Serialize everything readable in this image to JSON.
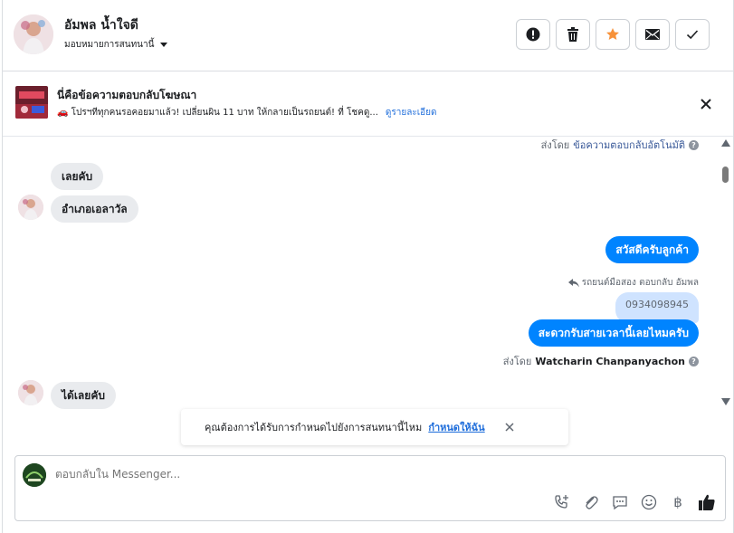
{
  "header": {
    "name": "อัมพล น้ำใจดี",
    "assign_label": "มอบหมายการสนทนานี้",
    "actions": [
      "mark-spam",
      "delete",
      "star",
      "mark-unread",
      "done"
    ]
  },
  "ad": {
    "title": "นี่คือข้อความตอบกลับโฆษณา",
    "snippet": "🚗 โปรฯทีทุกคนรอคอยมาแล้ว! เปลี่ยนผิน 11 บาท ให้กลายเป็นรถยนต์! ที่ โชคดู...",
    "detail_link": "ดูรายละเอียด"
  },
  "chat": {
    "auto_reply_meta": {
      "prefix": "ส่งโดย",
      "source": "ข้อความตอบกลับอัตโนมัติ"
    },
    "messages": [
      {
        "dir": "in",
        "text": "เลยคับ"
      },
      {
        "dir": "in",
        "text": "อำเภอเอลาวัล"
      },
      {
        "dir": "out",
        "text": "สวัสดีครับลูกค้า"
      },
      {
        "dir": "reply_tag",
        "text": "รถยนต์มือสอง ตอบกลับ อัมพล"
      },
      {
        "dir": "quote",
        "text": "0934098945"
      },
      {
        "dir": "out",
        "text": "สะดวกรับสายเวลานี้เลยไหมครับ"
      },
      {
        "dir": "in",
        "text": "ได้เลยคับ"
      }
    ],
    "sent_by_meta": {
      "prefix": "ส่งโดย",
      "agent": "Watcharin Chanpanyachon"
    }
  },
  "toast": {
    "text": "คุณต้องการได้รับการกำหนดไปยังการสนทนานี้ไหม",
    "link": "กำหนดให้ฉัน"
  },
  "composer": {
    "placeholder": "ตอบกลับใน Messenger...",
    "tools": [
      "call-add-icon",
      "attach-icon",
      "saved-reply-icon",
      "emoji-icon",
      "baht-icon",
      "like-icon"
    ]
  },
  "colors": {
    "accent": "#0084ff",
    "link": "#216fdb",
    "star": "#f7923a",
    "incoming_bubble": "#e9ebee",
    "quote_bubble": "#cfe3ff"
  }
}
